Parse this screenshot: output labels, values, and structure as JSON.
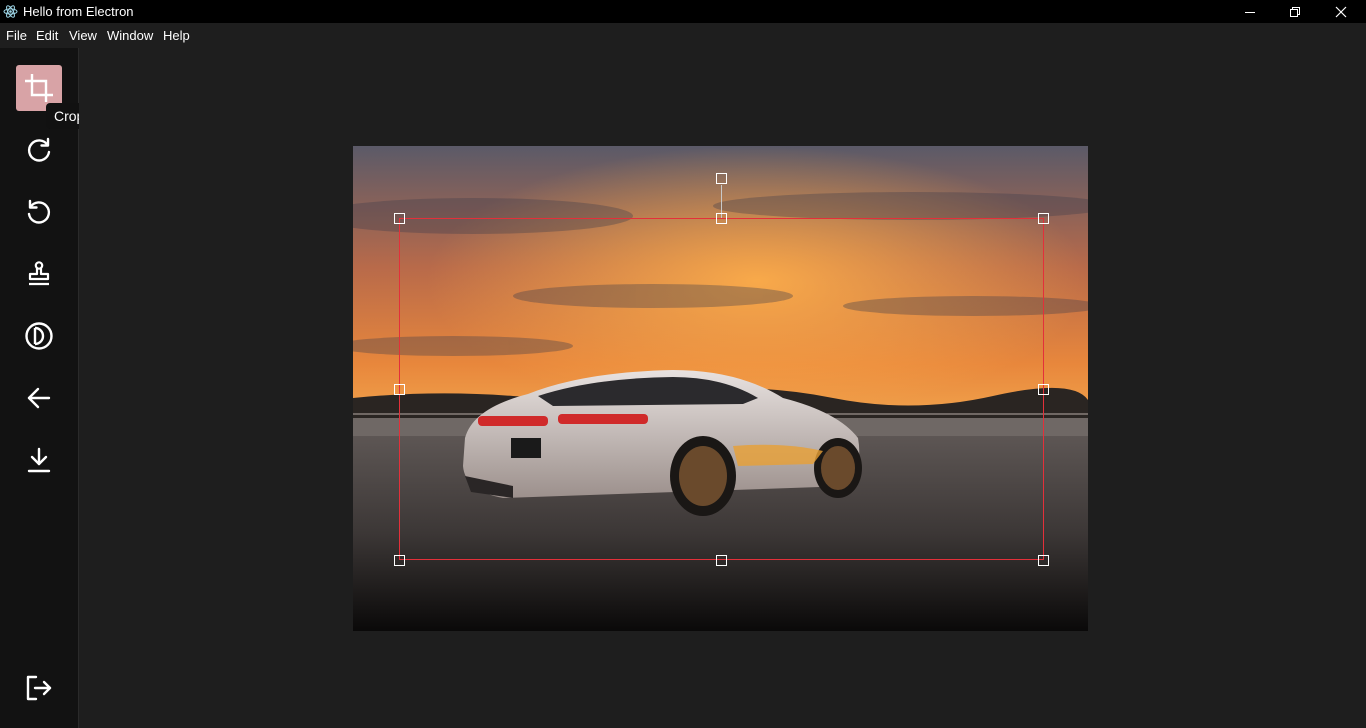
{
  "window": {
    "title": "Hello from Electron",
    "icon": "electron-atom-icon",
    "controls": [
      "minimize-icon",
      "restore-icon",
      "close-icon"
    ]
  },
  "menu": {
    "items": [
      "File",
      "Edit",
      "View",
      "Window",
      "Help"
    ]
  },
  "sidebar": {
    "tools": [
      {
        "name": "crop",
        "icon": "crop-icon",
        "active": true
      },
      {
        "name": "rotate-right",
        "icon": "rotate-clockwise-icon",
        "active": false
      },
      {
        "name": "rotate-left",
        "icon": "rotate-counterclockwise-icon",
        "active": false
      },
      {
        "name": "stamp",
        "icon": "stamp-icon",
        "active": false
      },
      {
        "name": "filter",
        "icon": "contrast-icon",
        "active": false
      },
      {
        "name": "back",
        "icon": "arrow-left-icon",
        "active": false
      },
      {
        "name": "download",
        "icon": "download-icon",
        "active": false
      }
    ],
    "logout_icon": "logout-icon",
    "tooltip": "Crop"
  },
  "colors": {
    "active_tool_bg": "#d8a3a6",
    "crop_border": "#e3303a",
    "sidebar_bg": "#121212",
    "canvas_bg": "#1e1e1e",
    "titlebar_bg": "#000000"
  }
}
